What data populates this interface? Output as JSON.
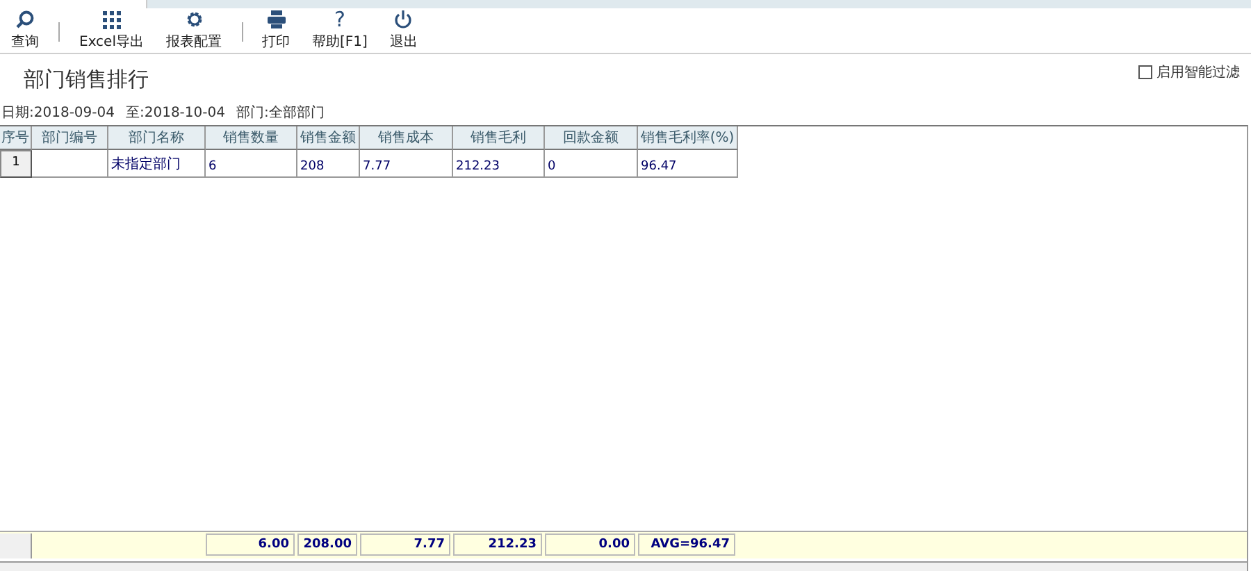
{
  "toolbar": [
    {
      "label": "查询",
      "separator_before": false
    },
    {
      "label": "Excel导出",
      "separator_before": true
    },
    {
      "label": "报表配置",
      "separator_before": false
    },
    {
      "label": "打印",
      "separator_before": true
    },
    {
      "label": "帮助[F1]",
      "glyph": "?",
      "separator_before": false
    },
    {
      "label": "退出",
      "separator_before": false
    }
  ],
  "title": "部门销售排行",
  "filter": {
    "label": "启用智能过滤",
    "checked": false
  },
  "criteria": [
    "日期:2018-09-04",
    "至:2018-10-04",
    "部门:全部部门"
  ],
  "table": {
    "columns": [
      "序号",
      "部门编号",
      "部门名称",
      "销售数量",
      "销售金额",
      "销售成本",
      "销售毛利",
      "回款金额",
      "销售毛利率(%)"
    ],
    "rows": [
      {
        "cells": [
          "1",
          "",
          "未指定部门",
          "6",
          "208",
          "7.77",
          "212.23",
          "0",
          "96.47"
        ]
      }
    ],
    "totals": [
      "6.00",
      "208.00",
      "7.77",
      "212.23",
      "0.00",
      "AVG=96.47"
    ]
  }
}
